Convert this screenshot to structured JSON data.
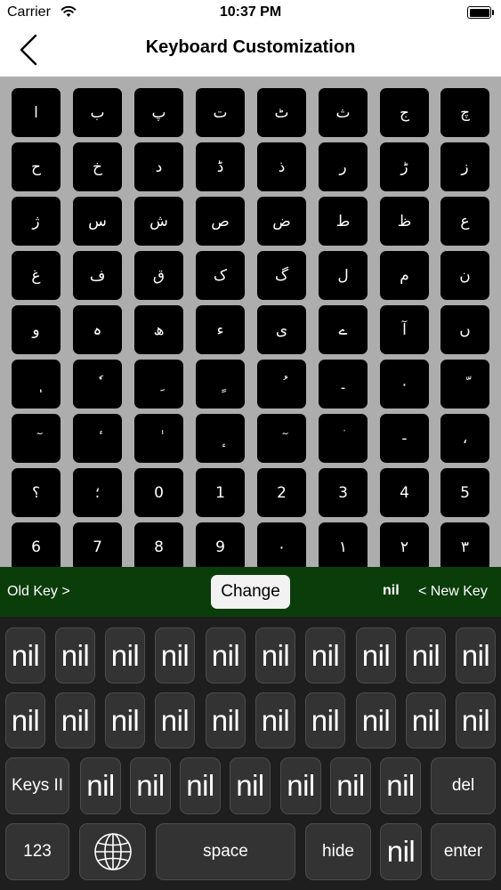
{
  "status_bar": {
    "carrier": "Carrier",
    "time": "10:37 PM"
  },
  "nav": {
    "title": "Keyboard Customization"
  },
  "old_keys": [
    [
      "ا",
      "ب",
      "پ",
      "ت",
      "ٹ",
      "ث",
      "ج",
      "چ"
    ],
    [
      "ح",
      "خ",
      "د",
      "ڈ",
      "ذ",
      "ر",
      "ڑ",
      "ز"
    ],
    [
      "ژ",
      "س",
      "ش",
      "ص",
      "ض",
      "ط",
      "ظ",
      "ع"
    ],
    [
      "غ",
      "ف",
      "ق",
      "ک",
      "گ",
      "ل",
      "م",
      "ن"
    ],
    [
      "و",
      "ہ",
      "ھ",
      "ء",
      "ی",
      "ے",
      "آ",
      "ں"
    ],
    [
      "ٖ",
      "ٗ",
      "ِ",
      "ٍ",
      "ُ",
      "۔",
      "٠",
      "ّ"
    ],
    [
      "ٓ",
      "ٔ",
      "ٰ",
      "ٕ",
      "ٓ",
      "ۛ",
      "-",
      "،"
    ],
    [
      "؟",
      "؛",
      "0",
      "1",
      "2",
      "3",
      "4",
      "5"
    ],
    [
      "6",
      "7",
      "8",
      "9",
      "۰",
      "۱",
      "۲",
      "۳"
    ]
  ],
  "change_bar": {
    "old_key_label": "Old Key >",
    "change_label": "Change",
    "selected_key": "nil",
    "new_key_label": "< New Key"
  },
  "new_keyboard": {
    "row1": [
      "nil",
      "nil",
      "nil",
      "nil",
      "nil",
      "nil",
      "nil",
      "nil",
      "nil",
      "nil"
    ],
    "row2": [
      "nil",
      "nil",
      "nil",
      "nil",
      "nil",
      "nil",
      "nil",
      "nil",
      "nil",
      "nil"
    ],
    "row3_first": "Keys II",
    "row3": [
      "nil",
      "nil",
      "nil",
      "nil",
      "nil",
      "nil",
      "nil"
    ],
    "row3_last": "del",
    "numbers": "123",
    "globe_icon": "globe-icon",
    "space": "space",
    "hide": "hide",
    "row4_nil": "nil",
    "enter": "enter"
  }
}
